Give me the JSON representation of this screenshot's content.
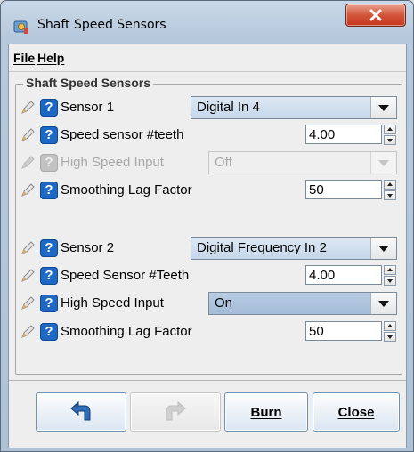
{
  "window": {
    "title": "Shaft Speed Sensors",
    "close_glyph": "x"
  },
  "menu": {
    "items": [
      {
        "label": "File"
      },
      {
        "label": "Help"
      }
    ]
  },
  "group": {
    "title": "Shaft Speed Sensors"
  },
  "rows": {
    "sensor1": {
      "label": "Sensor 1",
      "value": "Digital In 4",
      "enabled": true
    },
    "teeth1": {
      "label": "Speed sensor #teeth",
      "value": "4.00",
      "enabled": true
    },
    "highspeed1": {
      "label": "High Speed Input",
      "value": "Off",
      "enabled": false
    },
    "lag1": {
      "label": "Smoothing Lag Factor",
      "value": "50",
      "enabled": true
    },
    "sensor2": {
      "label": "Sensor 2",
      "value": "Digital Frequency In 2",
      "enabled": true
    },
    "teeth2": {
      "label": "Speed Sensor #Teeth",
      "value": "4.00",
      "enabled": true
    },
    "highspeed2": {
      "label": "High Speed Input",
      "value": "On",
      "enabled": true
    },
    "lag2": {
      "label": "Smoothing Lag Factor",
      "value": "50",
      "enabled": true
    }
  },
  "help_glyph": "?",
  "buttons": {
    "undo": {
      "icon": "undo-arrow-icon",
      "enabled": true
    },
    "redo": {
      "icon": "redo-arrow-icon",
      "enabled": false
    },
    "burn": {
      "label": "Burn",
      "enabled": true
    },
    "close": {
      "label": "Close",
      "enabled": true
    }
  },
  "colors": {
    "help_icon": "#1d68c5",
    "combo_gradient_top": "#dde8f3",
    "window_frame": "#aec2d6"
  }
}
